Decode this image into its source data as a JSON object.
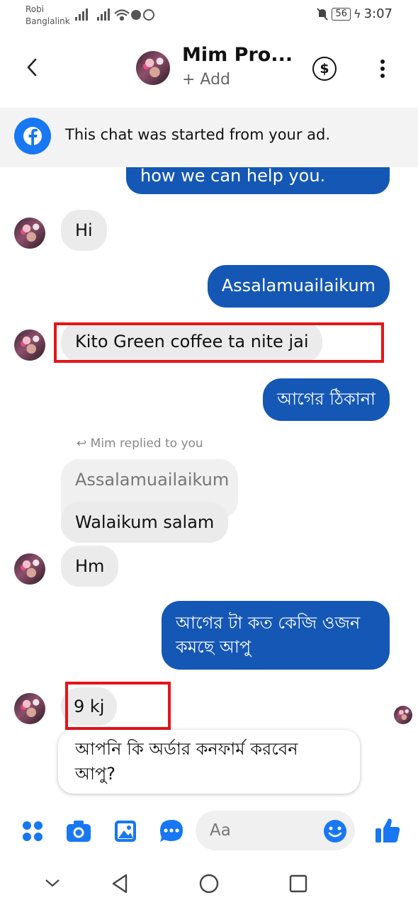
{
  "status_bar": {
    "carrier_1": "Robi",
    "carrier_2": "Banglalink",
    "battery": "56",
    "time": "3:07"
  },
  "header": {
    "contact_name": "Mim Pro...",
    "subtitle": "+ Add"
  },
  "ad_banner": {
    "text": "This chat was started from your ad."
  },
  "messages": {
    "m0": "how we can help you.",
    "m1": "Hi",
    "m2": "Assalamuailaikum",
    "m3": "Kito Green coffee ta nite jai",
    "m4": "আগের ঠিকানা",
    "replied_label": "Mim replied to you",
    "quoted": "Assalamuailaikum",
    "m5": "Walaikum salam",
    "m6": "Hm",
    "m7_line1": "আগের টা কত কেজি ওজন",
    "m7_line2": "কমছে আপু",
    "m8": "9 kj",
    "m9_line1": "আপনি কি অর্ডার কনফার্ম করবেন",
    "m9_line2": "আপু?"
  },
  "composer": {
    "placeholder": "Aa"
  },
  "colors": {
    "messenger_blue": "#1557b5",
    "facebook_blue": "#1877f2",
    "highlight_red": "#e5141a"
  }
}
